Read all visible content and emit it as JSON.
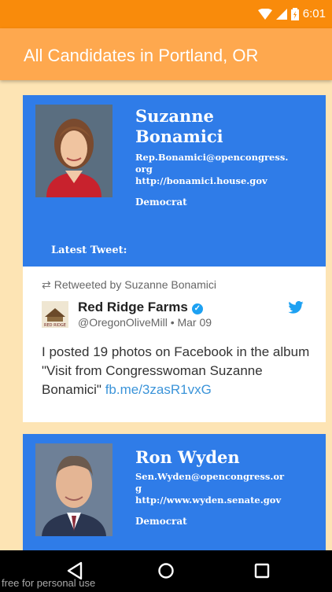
{
  "status_bar": {
    "time": "6:01"
  },
  "app_bar": {
    "title": "All Candidates in Portland, OR"
  },
  "candidates": [
    {
      "name_line1": "Suzanne",
      "name_line2": "Bonamici",
      "email_line1": "Rep.Bonamici@opencongress.",
      "email_line2": "org",
      "website": "http://bonamici.house.gov",
      "party": "Democrat",
      "latest_label": "Latest Tweet:"
    },
    {
      "name_line1": "Ron Wyden",
      "email_line1": "Sen.Wyden@opencongress.or",
      "email_line2": "g",
      "website": "http://www.wyden.senate.gov",
      "party": "Democrat"
    }
  ],
  "tweet": {
    "retweeted_by": "Retweeted by Suzanne Bonamici",
    "author_name": "Red Ridge Farms",
    "handle_date": "@OregonOliveMill • Mar 09",
    "text": "I posted 19 photos on Facebook in the album \"Visit from Congresswoman Suzanne Bonamici\" ",
    "link": "fb.me/3zasR1vxG",
    "avatar_text": "RED RIDGE"
  },
  "watermark": "free for personal use",
  "colors": {
    "status_bar": "#f98b0b",
    "app_bar": "#fea84e",
    "card": "#2f7ce8",
    "background": "#fde4b4",
    "link": "#3b94d9"
  }
}
